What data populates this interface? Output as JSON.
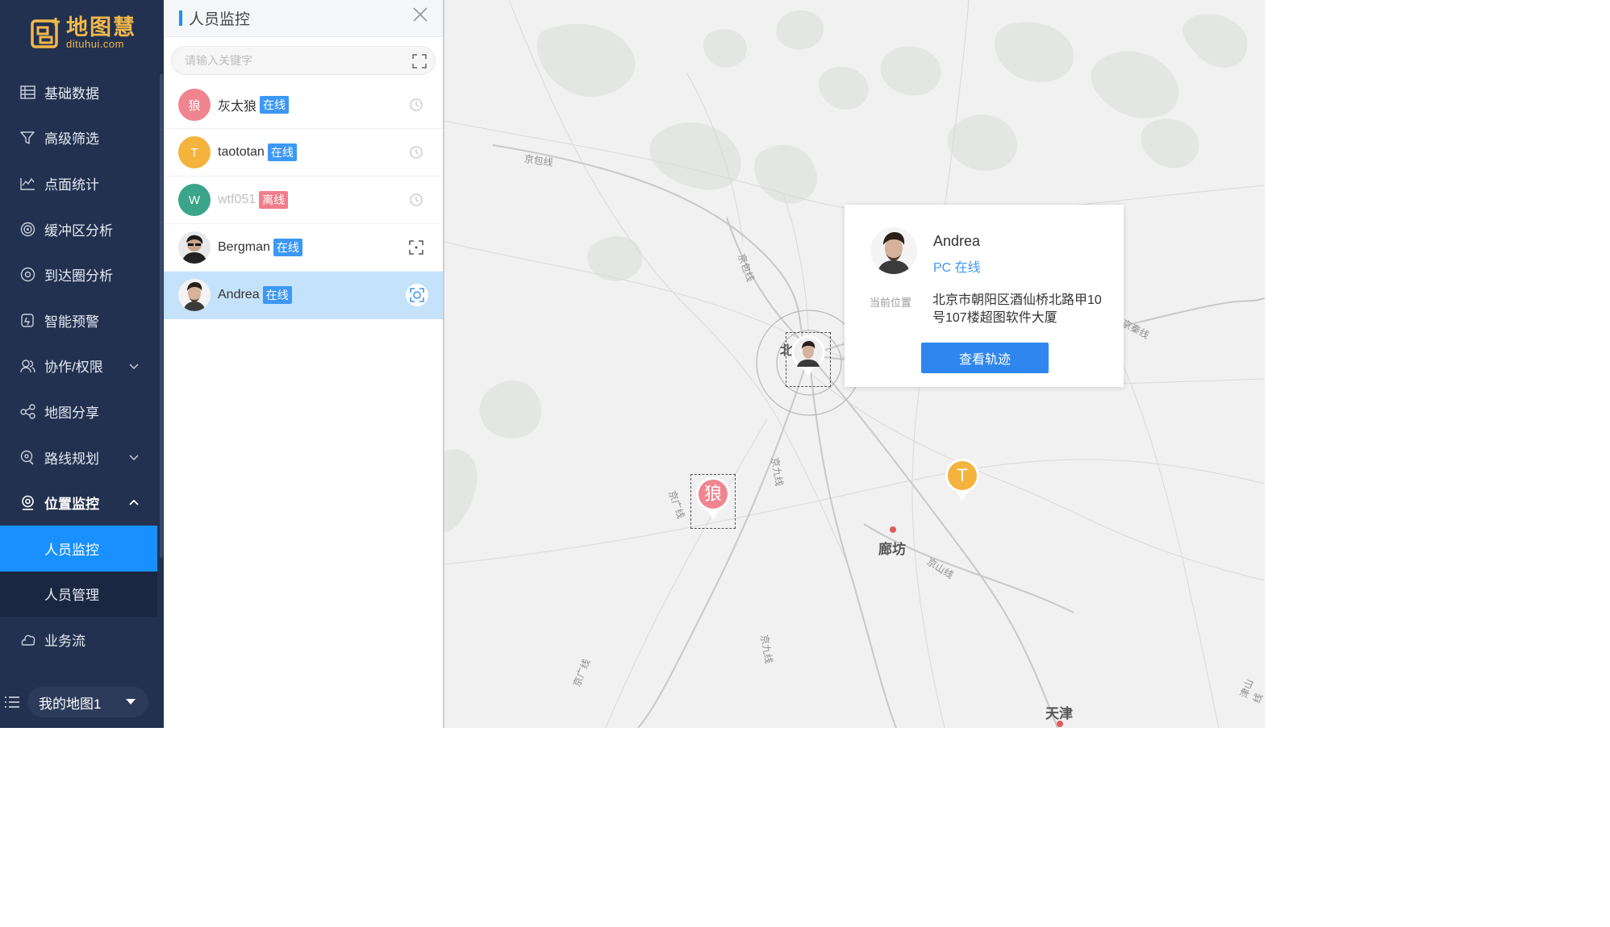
{
  "logo": {
    "cn": "地图慧",
    "en": "dituhui.com"
  },
  "menu": [
    {
      "label": "基础数据",
      "icon": "database-icon"
    },
    {
      "label": "高级筛选",
      "icon": "filter-icon"
    },
    {
      "label": "点面统计",
      "icon": "statistics-icon"
    },
    {
      "label": "缓冲区分析",
      "icon": "buffer-icon"
    },
    {
      "label": "到达圈分析",
      "icon": "reach-circle-icon"
    },
    {
      "label": "智能预警",
      "icon": "alert-icon"
    },
    {
      "label": "协作/权限",
      "icon": "users-icon"
    },
    {
      "label": "地图分享",
      "icon": "share-icon"
    },
    {
      "label": "路线规划",
      "icon": "route-icon"
    },
    {
      "label": "位置监控",
      "icon": "location-monitor-icon"
    },
    {
      "label": "业务流",
      "icon": "workflow-icon"
    }
  ],
  "submenu": [
    {
      "label": "人员监控"
    },
    {
      "label": "人员管理"
    }
  ],
  "map_selector": {
    "label": "我的地图1"
  },
  "panel": {
    "title": "人员监控",
    "search_placeholder": "请输入关键字",
    "users": [
      {
        "avatar_text": "狼",
        "avatar_color": "#f0848f",
        "name": "灰太狼",
        "status": "在线",
        "online": true,
        "action_icon": "history-icon"
      },
      {
        "avatar_text": "T",
        "avatar_color": "#f3b33d",
        "name": "taototan",
        "status": "在线",
        "online": true,
        "action_icon": "history-icon"
      },
      {
        "avatar_text": "W",
        "avatar_color": "#3aa58a",
        "name": "wtf051",
        "status": "离线",
        "online": false,
        "action_icon": "history-icon"
      },
      {
        "avatar_text": "",
        "avatar_color": "#444444",
        "name": "Bergman",
        "status": "在线",
        "online": true,
        "action_icon": "locate-icon"
      },
      {
        "avatar_text": "",
        "avatar_color": "#555555",
        "name": "Andrea",
        "status": "在线",
        "online": true,
        "action_icon": "locate-active-icon"
      }
    ]
  },
  "map": {
    "labels": {
      "jingbao1": "京包线",
      "jingbao2": "京包线",
      "jingjiu1": "京九线",
      "jingjiu2": "京九线",
      "jingguang1": "京广线",
      "jingguang2": "京广线",
      "jingshan": "京山线",
      "jingqin": "京秦线",
      "jinshan": "津山线",
      "bei": "北",
      "langfang": "廊坊",
      "tianjin": "天津"
    },
    "markers": {
      "wolf": "狼",
      "t": "T"
    }
  },
  "popup": {
    "name": "Andrea",
    "status": "PC 在线",
    "location_label": "当前位置",
    "address": "北京市朝阳区酒仙桥北路甲10号107楼超图软件大厦",
    "button": "查看轨迹"
  },
  "colors": {
    "sidebar": "#22314f",
    "accent": "#1890ff",
    "online": "#3d97f5",
    "offline": "#f07e8a",
    "logo": "#f2b84b"
  }
}
